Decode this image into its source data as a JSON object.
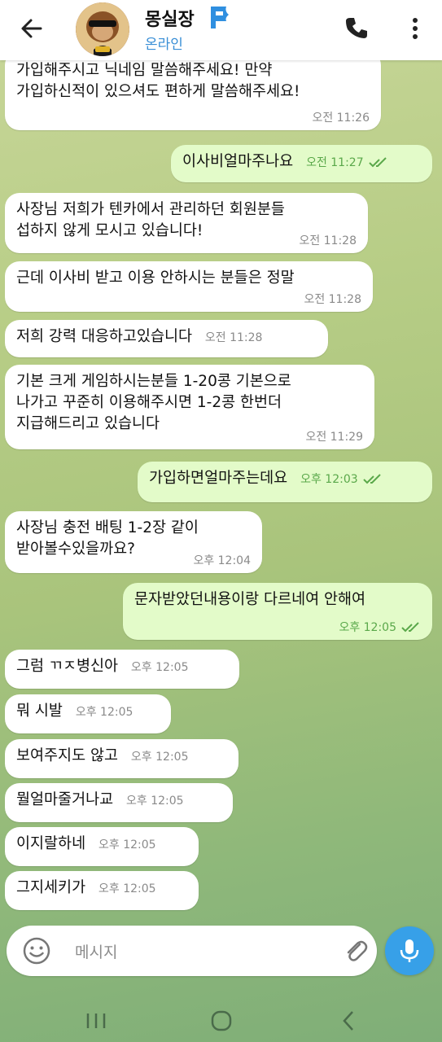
{
  "header": {
    "title": "몽실장",
    "status": "온라인"
  },
  "messages": [
    {
      "text": "가입해주시고 닉네임 말씀해주세요! 만약\n가입하신적이 있으셔도 편하게 말씀해주세요!",
      "time": "오전 11:26",
      "direction": "in"
    },
    {
      "text": "이사비얼마주나요",
      "time": "오전 11:27",
      "direction": "out",
      "read": true
    },
    {
      "text": "사장님 저희가 텐카에서 관리하던 회원분들\n섭하지 않게 모시고 있습니다!",
      "time": "오전 11:28",
      "direction": "in"
    },
    {
      "text": "근데 이사비 받고 이용 안하시는 분들은 정말",
      "time": "오전 11:28",
      "direction": "in"
    },
    {
      "text": "저희 강력 대응하고있습니다",
      "time": "오전 11:28",
      "direction": "in"
    },
    {
      "text": "기본 크게 게임하시는분들 1-20콩 기본으로\n나가고 꾸준히 이용해주시면 1-2콩 한번더\n지급해드리고 있습니다",
      "time": "오전 11:29",
      "direction": "in"
    },
    {
      "text": "가입하면얼마주는데요",
      "time": "오후 12:03",
      "direction": "out",
      "read": true
    },
    {
      "text": "사장님 충전 배팅 1-2장 같이\n받아볼수있을까요?",
      "time": "오후 12:04",
      "direction": "in"
    },
    {
      "text": "문자받았던내용이랑 다르네여 안해여",
      "time": "오후 12:05",
      "direction": "out",
      "read": true
    },
    {
      "text": "그럼 ㄲㅈ병신아",
      "time": "오후 12:05",
      "direction": "in"
    },
    {
      "text": "뭐 시발",
      "time": "오후 12:05",
      "direction": "in"
    },
    {
      "text": "보여주지도 않고",
      "time": "오후 12:05",
      "direction": "in"
    },
    {
      "text": "뭘얼마줄거나교",
      "time": "오후 12:05",
      "direction": "in"
    },
    {
      "text": "이지랄하네",
      "time": "오후 12:05",
      "direction": "in"
    },
    {
      "text": "그지세키가",
      "time": "오후 12:05",
      "direction": "in"
    }
  ],
  "composer": {
    "placeholder": "메시지"
  },
  "colors": {
    "incoming_bubble": "#ffffff",
    "outgoing_bubble": "#e3fbc9",
    "accent": "#37a0e8",
    "status_online": "#3a8fd6",
    "outgoing_time": "#5aa84a"
  },
  "icons": [
    "back-arrow-icon",
    "premium-flag-icon",
    "phone-icon",
    "more-vertical-icon",
    "emoji-icon",
    "attach-icon",
    "mic-icon",
    "read-ticks-icon",
    "nav-recent-icon",
    "nav-home-icon",
    "nav-back-icon"
  ]
}
